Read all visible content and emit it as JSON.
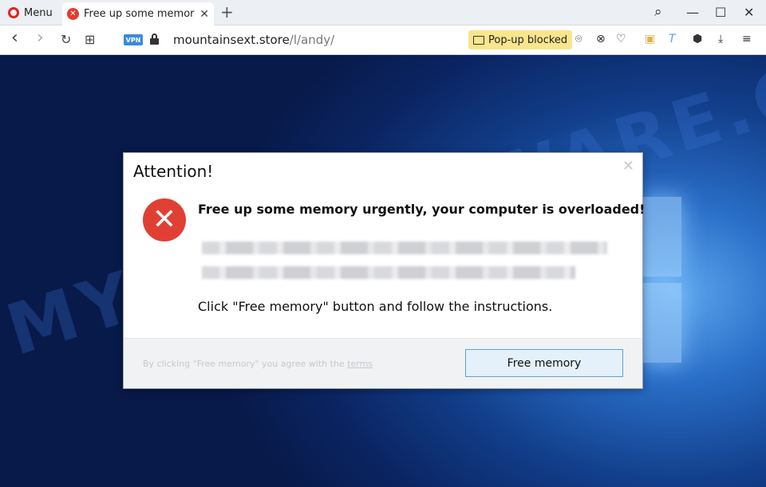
{
  "tabbar": {
    "menu_label": "Menu",
    "tab_title": "Free up some memory",
    "tab_close": "✕",
    "new_tab": "+",
    "search_glyph": "⌕",
    "minimize_glyph": "—",
    "maximize_glyph": "☐",
    "close_glyph": "✕"
  },
  "addressbar": {
    "back_glyph": "‹",
    "forward_glyph": "›",
    "reload_glyph": "↻",
    "speed_dial_glyph": "⊞",
    "vpn_label": "VPN",
    "url_host": "mountainsext.store",
    "url_path": "/l/andy/",
    "popup_blocked_label": "Pop-up blocked",
    "tools": [
      "⌾",
      "⊗",
      "♡",
      "▣",
      "T",
      "⬢",
      "⤓",
      "≡"
    ]
  },
  "page": {
    "watermark": "MYANTISPYWARE.COM"
  },
  "dialog": {
    "title": "Attention!",
    "close_glyph": "✕",
    "error_glyph": "✕",
    "headline": "Free up some memory urgently, your computer is overloaded!",
    "instruction": "Click \"Free memory\" button and follow the instructions.",
    "terms_prefix": "By clicking \"Free memory\" you agree with the ",
    "terms_link": "terms",
    "button_label": "Free memory"
  },
  "colors": {
    "popup_blocked_bg": "#f8e58c",
    "error_red": "#e04033",
    "button_border": "#5aa0d6",
    "vpn_blue": "#3a8bd9"
  }
}
